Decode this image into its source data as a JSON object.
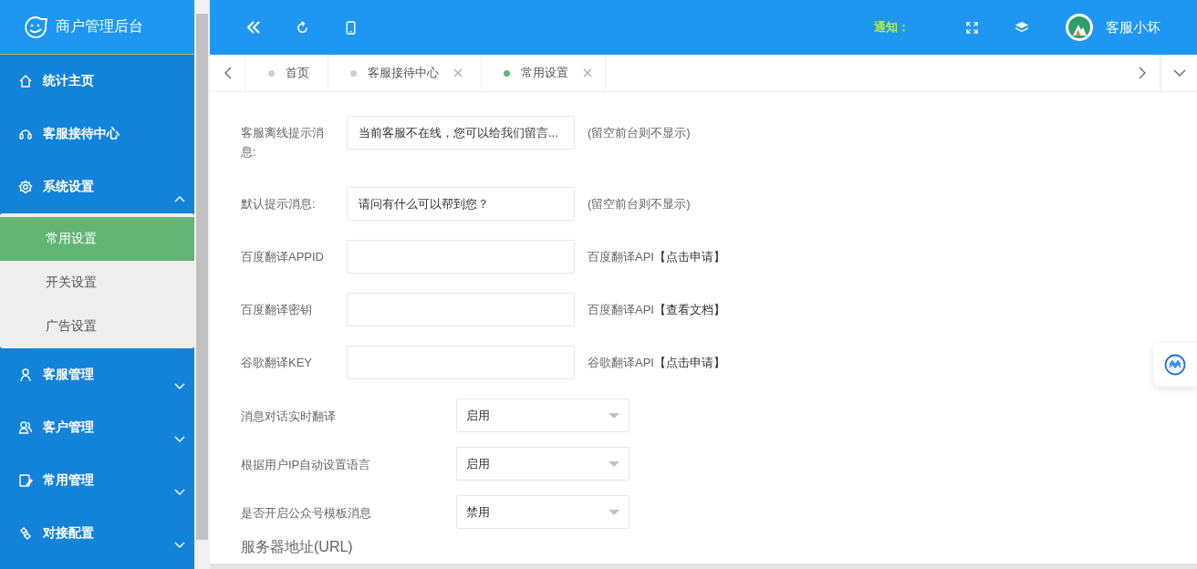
{
  "header": {
    "title": "商户管理后台",
    "notice": "通知：",
    "user": "客服小坏"
  },
  "sidebar": {
    "items": [
      {
        "kind": "link",
        "label": "统计主页"
      },
      {
        "kind": "link",
        "label": "客服接待中心"
      },
      {
        "kind": "group",
        "label": "系统设置",
        "expanded": true,
        "children": [
          {
            "label": "常用设置",
            "selected": true
          },
          {
            "label": "开关设置",
            "selected": false
          },
          {
            "label": "广告设置",
            "selected": false
          }
        ]
      },
      {
        "kind": "group",
        "label": "客服管理",
        "expanded": false
      },
      {
        "kind": "group",
        "label": "客户管理",
        "expanded": false
      },
      {
        "kind": "group",
        "label": "常用管理",
        "expanded": false
      },
      {
        "kind": "group",
        "label": "对接配置",
        "expanded": false
      }
    ]
  },
  "tabs": [
    {
      "label": "首页",
      "selected": false,
      "closable": false
    },
    {
      "label": "客服接待中心",
      "selected": false,
      "closable": true
    },
    {
      "label": "常用设置",
      "selected": true,
      "closable": true
    }
  ],
  "form": {
    "rows": [
      {
        "kind": "input",
        "label": "客服离线提示消息:",
        "value": "当前客服不在线，您可以给我们留言...",
        "hint": "(留空前台则不显示)"
      },
      {
        "kind": "input",
        "label": "默认提示消息:",
        "value": "请问有什么可以帮到您？",
        "hint": "(留空前台则不显示)"
      },
      {
        "kind": "input",
        "label": "百度翻译APPID",
        "hint": "百度翻译API",
        "link": "【点击申请】"
      },
      {
        "kind": "input",
        "label": "百度翻译密钥",
        "hint": "百度翻译API",
        "link": "【查看文档】"
      },
      {
        "kind": "input",
        "label": "谷歌翻译KEY",
        "hint": "谷歌翻译API",
        "link": "【点击申请】"
      },
      {
        "kind": "select",
        "label": "消息对话实时翻译",
        "value": "启用"
      },
      {
        "kind": "select",
        "label": "根据用户IP自动设置语言",
        "value": "启用"
      },
      {
        "kind": "select",
        "label": "是否开启公众号模板消息",
        "value": "禁用"
      }
    ],
    "section_title": "服务器地址(URL)"
  }
}
